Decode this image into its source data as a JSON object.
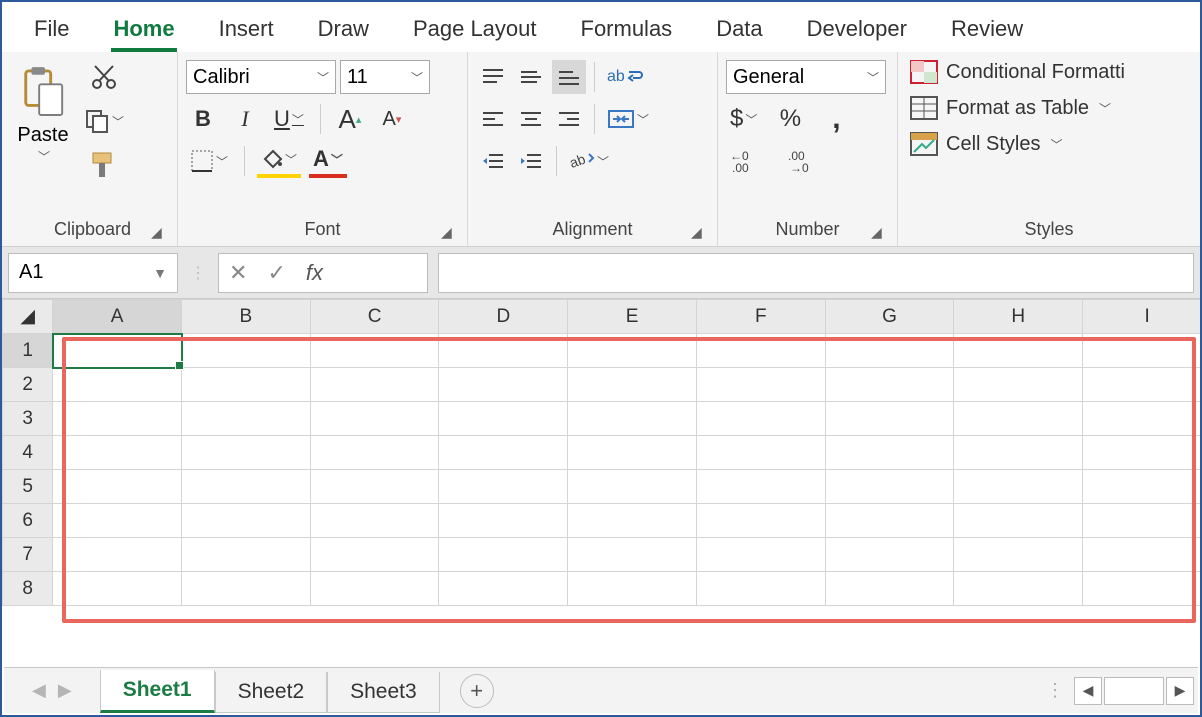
{
  "tabs": {
    "file": "File",
    "home": "Home",
    "insert": "Insert",
    "draw": "Draw",
    "pageLayout": "Page Layout",
    "formulas": "Formulas",
    "data": "Data",
    "developer": "Developer",
    "review": "Review",
    "active": "Home"
  },
  "ribbon": {
    "clipboard": {
      "label": "Clipboard",
      "paste": "Paste"
    },
    "font": {
      "label": "Font",
      "name": "Calibri",
      "size": "11",
      "bold": "B",
      "italic": "I",
      "underline": "U",
      "increase": "A",
      "decrease": "A"
    },
    "alignment": {
      "label": "Alignment",
      "wrap": "ab"
    },
    "number": {
      "label": "Number",
      "format": "General",
      "currency": "$",
      "percent": "%",
      "comma": ","
    },
    "styles": {
      "label": "Styles",
      "conditional": "Conditional Formatti",
      "table": "Format as Table",
      "cell": "Cell Styles"
    }
  },
  "formulaBar": {
    "nameBox": "A1",
    "cancel": "✕",
    "enter": "✓",
    "fx": "fx",
    "value": ""
  },
  "grid": {
    "columns": [
      "A",
      "B",
      "C",
      "D",
      "E",
      "F",
      "G",
      "H",
      "I"
    ],
    "rows": [
      "1",
      "2",
      "3",
      "4",
      "5",
      "6",
      "7",
      "8"
    ],
    "selectedCell": "A1"
  },
  "sheets": {
    "items": [
      "Sheet1",
      "Sheet2",
      "Sheet3"
    ],
    "active": "Sheet1",
    "add": "+"
  }
}
